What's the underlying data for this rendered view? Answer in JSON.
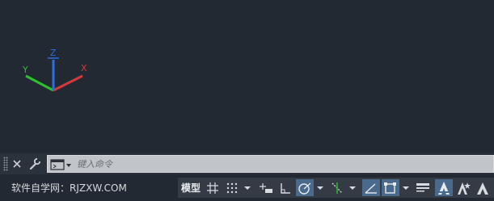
{
  "canvas": {
    "ucs": {
      "x_label": "X",
      "y_label": "Y",
      "z_label": "Z",
      "colors": {
        "x": "#d43a3a",
        "y": "#2cc02c",
        "z": "#2a6ee0"
      }
    }
  },
  "command_line": {
    "input_placeholder": "键入命令",
    "close_icon": "close-icon",
    "customize_icon": "wrench-icon",
    "prompt_icon": "command-prompt-icon"
  },
  "status_bar": {
    "watermark": "软件自学网：RJZXW.COM",
    "model_label": "模型",
    "active_color": "#4a6a8c",
    "tools": [
      {
        "name": "grid-display-icon",
        "active": false
      },
      {
        "name": "snap-mode-icon",
        "active": false
      },
      {
        "name": "infer-constraints-icon",
        "active": false
      },
      {
        "name": "ortho-mode-icon",
        "active": false
      },
      {
        "name": "polar-tracking-icon",
        "active": true
      },
      {
        "name": "object-snap-tracking-icon",
        "active": false
      },
      {
        "name": "dynamic-ucs-icon",
        "active": true
      },
      {
        "name": "object-snap-icon",
        "active": true
      },
      {
        "name": "lineweight-icon",
        "active": false
      },
      {
        "name": "annotation-scale-icon",
        "active": true
      },
      {
        "name": "annotation-visibility-icon",
        "active": false
      },
      {
        "name": "auto-scale-icon",
        "active": false
      }
    ]
  }
}
